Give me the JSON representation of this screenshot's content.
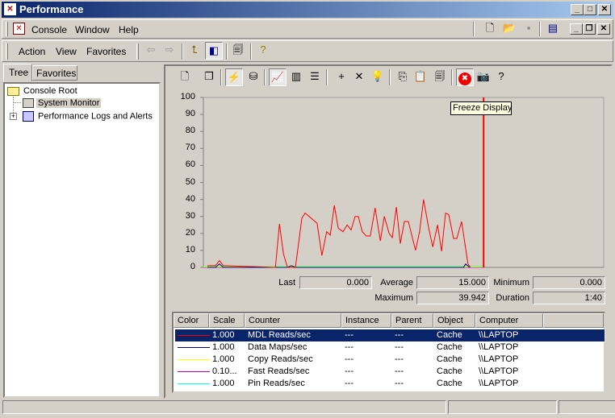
{
  "window": {
    "title": "Performance"
  },
  "menubar": {
    "items": [
      "Console",
      "Window",
      "Help"
    ]
  },
  "actionbar": {
    "items": [
      "Action",
      "View",
      "Favorites"
    ]
  },
  "left_pane": {
    "tabs": [
      "Tree",
      "Favorites"
    ],
    "active_tab": "Tree",
    "tree": [
      {
        "label": "Console Root",
        "icon": "folder-icon"
      },
      {
        "label": "System Monitor",
        "icon": "system-monitor-icon",
        "selected": true
      },
      {
        "label": "Performance Logs and Alerts",
        "icon": "perf-logs-icon",
        "expandable": true
      }
    ]
  },
  "monitor_toolbar": {
    "buttons": [
      {
        "name": "new-counter-set",
        "glyph": "🗋"
      },
      {
        "name": "clear-display",
        "glyph": "❐"
      },
      {
        "name": "view-current-activity",
        "glyph": "⚡",
        "pressed": true
      },
      {
        "name": "view-log-data",
        "glyph": "⛁"
      },
      {
        "name": "view-graph",
        "glyph": "📈",
        "pressed": true
      },
      {
        "name": "view-histogram",
        "glyph": "▥"
      },
      {
        "name": "view-report",
        "glyph": "☰"
      },
      {
        "name": "add-counter",
        "glyph": "+"
      },
      {
        "name": "delete-counter",
        "glyph": "✕"
      },
      {
        "name": "highlight",
        "glyph": "💡"
      },
      {
        "name": "copy-properties",
        "glyph": "⎘"
      },
      {
        "name": "paste-counter-list",
        "glyph": "📋"
      },
      {
        "name": "properties",
        "glyph": "🗐"
      },
      {
        "name": "freeze-display",
        "glyph": "✖",
        "pressed": true
      },
      {
        "name": "update-data",
        "glyph": "📷"
      },
      {
        "name": "help",
        "glyph": "?"
      }
    ]
  },
  "tooltip": "Freeze Display",
  "stats": {
    "last_label": "Last",
    "last": "0.000",
    "average_label": "Average",
    "average": "15.000",
    "minimum_label": "Minimum",
    "minimum": "0.000",
    "maximum_label": "Maximum",
    "maximum": "39.942",
    "duration_label": "Duration",
    "duration": "1:40"
  },
  "counters": {
    "columns": [
      "Color",
      "Scale",
      "Counter",
      "Instance",
      "Parent",
      "Object",
      "Computer"
    ],
    "rows": [
      {
        "color": "#ff0000",
        "scale": "1.000",
        "counter": "MDL Reads/sec",
        "instance": "---",
        "parent": "---",
        "object": "Cache",
        "computer": "\\\\LAPTOP",
        "selected": true
      },
      {
        "color": "#000080",
        "scale": "1.000",
        "counter": "Data Maps/sec",
        "instance": "---",
        "parent": "---",
        "object": "Cache",
        "computer": "\\\\LAPTOP"
      },
      {
        "color": "#ffff00",
        "scale": "1.000",
        "counter": "Copy Reads/sec",
        "instance": "---",
        "parent": "---",
        "object": "Cache",
        "computer": "\\\\LAPTOP"
      },
      {
        "color": "#c000c0",
        "scale": "0.10...",
        "counter": "Fast Reads/sec",
        "instance": "---",
        "parent": "---",
        "object": "Cache",
        "computer": "\\\\LAPTOP"
      },
      {
        "color": "#00ffff",
        "scale": "1.000",
        "counter": "Pin Reads/sec",
        "instance": "---",
        "parent": "---",
        "object": "Cache",
        "computer": "\\\\LAPTOP"
      }
    ]
  },
  "chart_data": {
    "type": "line",
    "ylim": [
      0,
      100
    ],
    "xlim": [
      0,
      100
    ],
    "yticks": [
      0,
      10,
      20,
      30,
      40,
      50,
      60,
      70,
      80,
      90,
      100
    ],
    "grid": false,
    "freeze_bar_at": 70,
    "freeze_bar_color": "#ff0000",
    "series": [
      {
        "name": "MDL Reads/sec",
        "color": "#ff0000",
        "points": [
          [
            1,
            1
          ],
          [
            3,
            1
          ],
          [
            4,
            4
          ],
          [
            5,
            1
          ],
          [
            18,
            0
          ],
          [
            19,
            25.6
          ],
          [
            20,
            8
          ],
          [
            21,
            0
          ],
          [
            23,
            0
          ],
          [
            24.6,
            29
          ],
          [
            25.4,
            32
          ],
          [
            28.4,
            26
          ],
          [
            29.6,
            7
          ],
          [
            30.8,
            21
          ],
          [
            31.7,
            19
          ],
          [
            32.7,
            36.5
          ],
          [
            33.7,
            23
          ],
          [
            34.9,
            21
          ],
          [
            35.9,
            25
          ],
          [
            36.9,
            22
          ],
          [
            37.9,
            30
          ],
          [
            38.7,
            30
          ],
          [
            39.7,
            21
          ],
          [
            40.7,
            18.5
          ],
          [
            41.7,
            18.5
          ],
          [
            42.9,
            35
          ],
          [
            44.2,
            15.6
          ],
          [
            45.2,
            30
          ],
          [
            46.4,
            20
          ],
          [
            47.2,
            17.5
          ],
          [
            48.2,
            35.5
          ],
          [
            49.2,
            14
          ],
          [
            50.2,
            27
          ],
          [
            51.2,
            27
          ],
          [
            53,
            10
          ],
          [
            54,
            21
          ],
          [
            55,
            39.9
          ],
          [
            56.3,
            23
          ],
          [
            57.3,
            12
          ],
          [
            58.5,
            25
          ],
          [
            59.5,
            9.5
          ],
          [
            60.5,
            32
          ],
          [
            61.3,
            31
          ],
          [
            62.5,
            17
          ],
          [
            63.3,
            17
          ],
          [
            64.5,
            27
          ],
          [
            66.1,
            2
          ],
          [
            66.7,
            0
          ]
        ]
      },
      {
        "name": "Data Maps/sec",
        "color": "#000080",
        "points": [
          [
            1,
            0
          ],
          [
            3,
            0
          ],
          [
            4,
            2
          ],
          [
            5,
            0
          ],
          [
            21,
            0
          ],
          [
            22,
            1
          ],
          [
            23,
            0
          ],
          [
            65,
            0
          ],
          [
            65.5,
            2
          ],
          [
            66.5,
            0
          ]
        ]
      },
      {
        "name": "Copy Reads/sec",
        "color": "#ffff00",
        "points": [
          [
            0,
            0.3
          ],
          [
            70,
            0.3
          ]
        ]
      },
      {
        "name": "Fast Reads/sec",
        "color": "#c000c0",
        "points": [
          [
            0,
            0
          ],
          [
            70,
            0
          ]
        ]
      },
      {
        "name": "Pin Reads/sec",
        "color": "#00ffff",
        "points": [
          [
            0,
            0.6
          ],
          [
            70,
            0.6
          ]
        ]
      }
    ]
  }
}
